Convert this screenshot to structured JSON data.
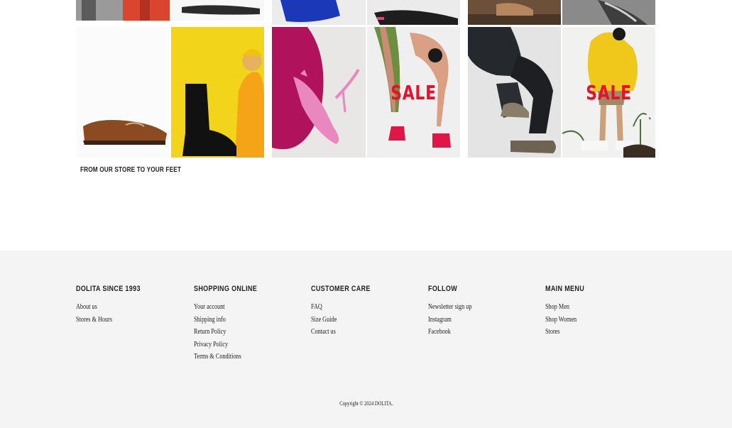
{
  "gallery": {
    "tagline": "FROM OUR STORE TO YOUR FEET",
    "sale_badge": "SALE"
  },
  "footer": {
    "columns": [
      {
        "title": "DOLITA SINCE 1993",
        "links": [
          "About us",
          "Stores & Hours"
        ]
      },
      {
        "title": "SHOPPING ONLINE",
        "links": [
          "Your account",
          "Shipping info",
          "Return Policy",
          "Privacy Policy",
          "Terms & Conditions"
        ]
      },
      {
        "title": "CUSTOMER CARE",
        "links": [
          "FAQ",
          "Size Guide",
          "Contact us"
        ]
      },
      {
        "title": "FOLLOW",
        "links": [
          "Newsletter sign up",
          "Instagram",
          "Facebook"
        ]
      },
      {
        "title": "MAIN MENU",
        "links": [
          "Shop Men",
          "Shop Women",
          "Stores"
        ]
      }
    ],
    "copyright": "Copyright © 2024 DOLITA."
  }
}
